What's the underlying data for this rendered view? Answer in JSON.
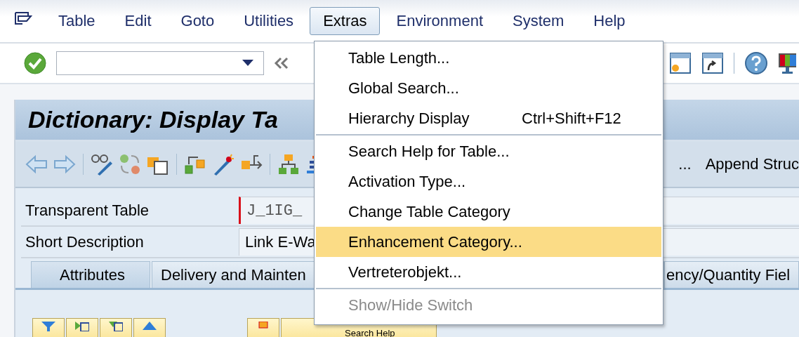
{
  "menu_bar": [
    {
      "label": "Table",
      "selected": false
    },
    {
      "label": "Edit",
      "selected": false
    },
    {
      "label": "Goto",
      "selected": false
    },
    {
      "label": "Utilities",
      "selected": false
    },
    {
      "label": "Extras",
      "selected": true
    },
    {
      "label": "Environment",
      "selected": false
    },
    {
      "label": "System",
      "selected": false
    },
    {
      "label": "Help",
      "selected": false
    }
  ],
  "title": "Dictionary: Display Ta",
  "app_toolbar": {
    "text_1": "...",
    "text_2": "Append Struc"
  },
  "fields": [
    {
      "label": "Transparent Table",
      "value": "J_1IG_",
      "required": true
    },
    {
      "label": "Short Description",
      "value": "Link E-Wa",
      "required": false
    }
  ],
  "tabs": [
    {
      "label": "Attributes",
      "selected": true
    },
    {
      "label": "Delivery and Mainten",
      "selected": false
    },
    {
      "label": "ency/Quantity Fiel",
      "selected": false
    }
  ],
  "bottom_button": "Search Help",
  "extras_menu": {
    "groups": [
      [
        {
          "label": "Table Length...",
          "selected": false,
          "disabled": false
        },
        {
          "label": "Global Search...",
          "selected": false,
          "disabled": false
        },
        {
          "label": "Hierarchy Display",
          "shortcut": "Ctrl+Shift+F12",
          "selected": false,
          "disabled": false
        }
      ],
      [
        {
          "label": "Search Help for Table...",
          "selected": false,
          "disabled": false
        },
        {
          "label": "Activation Type...",
          "selected": false,
          "disabled": false
        },
        {
          "label": "Change Table Category",
          "selected": false,
          "disabled": false
        },
        {
          "label": "Enhancement Category...",
          "selected": true,
          "disabled": false
        },
        {
          "label": "Vertreterobjekt...",
          "selected": false,
          "disabled": false
        }
      ],
      [
        {
          "label": "Show/Hide Switch",
          "selected": false,
          "disabled": true
        }
      ]
    ]
  }
}
